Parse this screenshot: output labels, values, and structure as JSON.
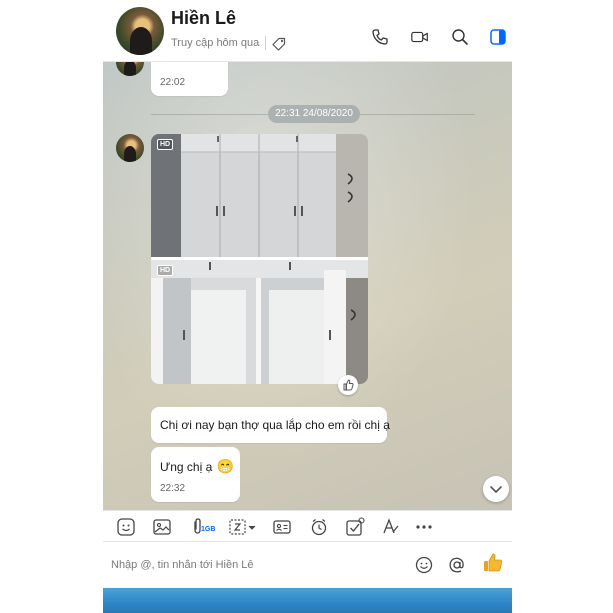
{
  "header": {
    "contact_name": "Hiền Lê",
    "status": "Truy cập hôm qua",
    "accent_color": "#0068ff",
    "icons": [
      "tag-icon",
      "phone-icon",
      "video-call-icon",
      "search-icon",
      "sidebar-panel-icon"
    ]
  },
  "messages": {
    "first_time": "22:02",
    "date_separator": "22:31 24/08/2020",
    "photo_badge_1": "HD",
    "photo_badge_2": "HD",
    "text_1": "Chị ơi nay bạn thợ qua lắp cho em rồi chị ạ",
    "text_2": "Ưng chị ạ",
    "text_2_emoji": "😁",
    "text_2_time": "22:32"
  },
  "toolbar": {
    "file_size_label": "1GB",
    "icons": [
      "sticker-icon",
      "image-icon",
      "attach-file-icon",
      "screenshot-icon",
      "contact-card-icon",
      "reminder-clock-icon",
      "task-check-icon",
      "text-format-icon",
      "more-icon"
    ]
  },
  "composer": {
    "placeholder": "Nhập @, tin nhắn tới Hiền Lê",
    "icons": [
      "emoji-icon",
      "mention-icon",
      "like-thumb-icon"
    ]
  }
}
